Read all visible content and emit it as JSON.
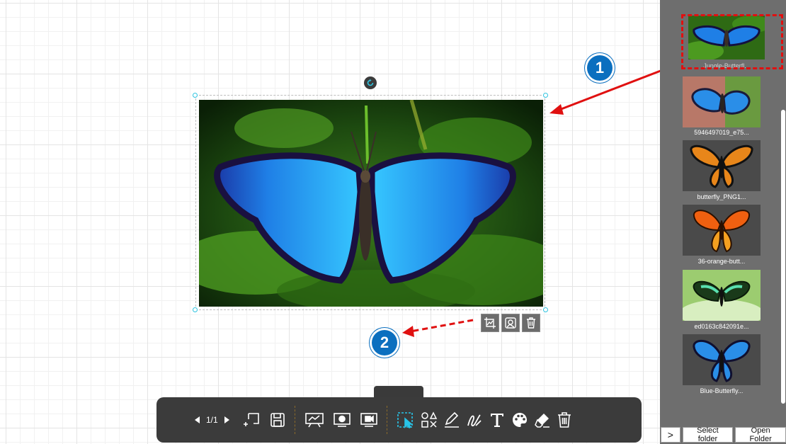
{
  "canvas": {
    "page_indicator": "1/1"
  },
  "image_toolbar": {
    "crop": "crop-icon",
    "replace": "image-icon",
    "delete": "trash-icon"
  },
  "callouts": {
    "one": "1",
    "two": "2"
  },
  "toolbar": {
    "items": [
      "prev-page-icon",
      "next-page-icon",
      "add-page-icon",
      "save-icon",
      "whiteboard-icon",
      "camera-icon",
      "video-icon",
      "select-icon",
      "shapes-icon",
      "pen-icon",
      "brush-icon",
      "text-icon",
      "palette-icon",
      "eraser-icon",
      "trash-icon"
    ]
  },
  "sidebar": {
    "thumbnails": [
      {
        "label": "Jungle-Butterfl..."
      },
      {
        "label": "5946497019_e75..."
      },
      {
        "label": "butterfly_PNG1..."
      },
      {
        "label": "36-orange-butt..."
      },
      {
        "label": "ed0163c842091e..."
      },
      {
        "label": "Blue-Butterfly..."
      }
    ],
    "expand_button": ">",
    "select_folder": "Select folder",
    "open_folder": "Open Folder"
  },
  "colors": {
    "accent": "#2ec4e0",
    "callout": "#0b6fbf",
    "annotation_arrow": "#e01010",
    "toolbar_bg": "#3b3b3b",
    "sidebar_bg": "#6e6e6e",
    "selection_icon": "#28c4e8"
  }
}
